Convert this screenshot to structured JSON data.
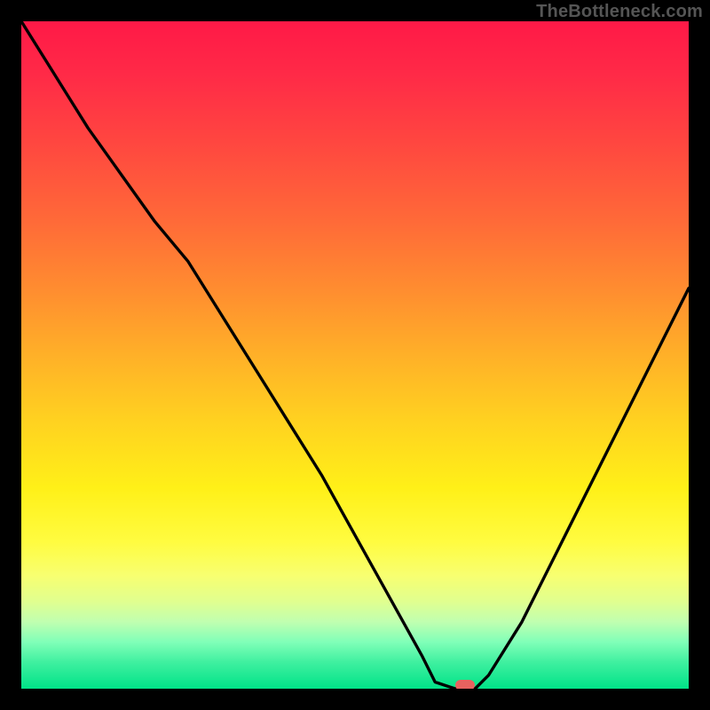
{
  "watermark": "TheBottleneck.com",
  "chart_data": {
    "type": "line",
    "title": "",
    "xlabel": "",
    "ylabel": "",
    "xlim": [
      0,
      100
    ],
    "ylim": [
      0,
      100
    ],
    "grid": false,
    "series": [
      {
        "name": "bottleneck-curve",
        "x": [
          0,
          5,
          10,
          15,
          20,
          25,
          30,
          35,
          40,
          45,
          50,
          55,
          60,
          62,
          65,
          68,
          70,
          75,
          80,
          85,
          90,
          95,
          100
        ],
        "values": [
          100,
          92,
          84,
          77,
          70,
          64,
          56,
          48,
          40,
          32,
          23,
          14,
          5,
          1,
          0,
          0,
          2,
          10,
          20,
          30,
          40,
          50,
          60
        ]
      }
    ],
    "marker": {
      "x": 66.5,
      "y": 0
    },
    "background_gradient": {
      "orientation": "vertical",
      "stops": [
        {
          "pos": 0,
          "color": "#ff1947"
        },
        {
          "pos": 8,
          "color": "#ff2a47"
        },
        {
          "pos": 18,
          "color": "#ff4640"
        },
        {
          "pos": 30,
          "color": "#ff6a38"
        },
        {
          "pos": 40,
          "color": "#ff8c30"
        },
        {
          "pos": 50,
          "color": "#ffb028"
        },
        {
          "pos": 60,
          "color": "#ffd220"
        },
        {
          "pos": 70,
          "color": "#fff018"
        },
        {
          "pos": 78,
          "color": "#fffc40"
        },
        {
          "pos": 83,
          "color": "#f8ff70"
        },
        {
          "pos": 87,
          "color": "#e0ff90"
        },
        {
          "pos": 90,
          "color": "#c0ffb0"
        },
        {
          "pos": 93,
          "color": "#80ffb8"
        },
        {
          "pos": 96,
          "color": "#40f0a0"
        },
        {
          "pos": 100,
          "color": "#00e388"
        }
      ]
    }
  }
}
